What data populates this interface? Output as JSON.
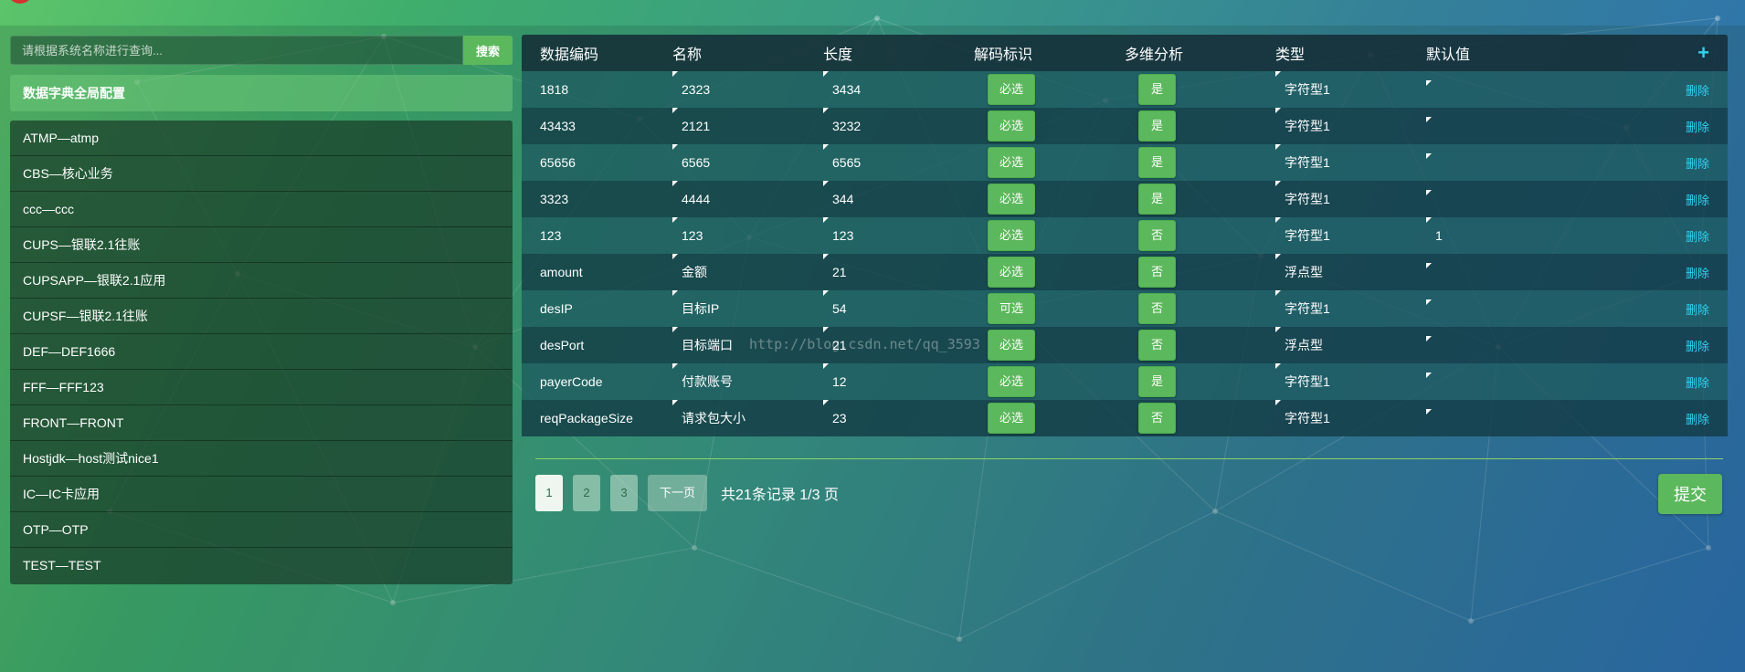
{
  "colors": {
    "accent_green": "#5cb85c",
    "link_cyan": "#2fd3f0"
  },
  "sidebar": {
    "search": {
      "placeholder": "请根据系统名称进行查询...",
      "button_label": "搜索"
    },
    "global_config_label": "数据字典全局配置",
    "systems": [
      "ATMP—atmp",
      "CBS—核心业务",
      "ccc—ccc",
      "CUPS—银联2.1往账",
      "CUPSAPP—银联2.1应用",
      "CUPSF—银联2.1往账",
      "DEF—DEF1666",
      "FFF—FFF123",
      "FRONT—FRONT",
      "Hostjdk—host测试nice1",
      "IC—IC卡应用",
      "OTP—OTP",
      "TEST—TEST"
    ]
  },
  "table": {
    "headers": [
      "数据编码",
      "名称",
      "长度",
      "解码标识",
      "多维分析",
      "类型",
      "默认值"
    ],
    "add_icon": "plus-icon",
    "add_symbol": "+",
    "delete_label": "删除",
    "rows": [
      {
        "code": "1818",
        "name": "2323",
        "length": "3434",
        "decode": "必选",
        "multi": "是",
        "type": "字符型1",
        "default": ""
      },
      {
        "code": "43433",
        "name": "2121",
        "length": "3232",
        "decode": "必选",
        "multi": "是",
        "type": "字符型1",
        "default": ""
      },
      {
        "code": "65656",
        "name": "6565",
        "length": "6565",
        "decode": "必选",
        "multi": "是",
        "type": "字符型1",
        "default": ""
      },
      {
        "code": "3323",
        "name": "4444",
        "length": "344",
        "decode": "必选",
        "multi": "是",
        "type": "字符型1",
        "default": ""
      },
      {
        "code": "123",
        "name": "123",
        "length": "123",
        "decode": "必选",
        "multi": "否",
        "type": "字符型1",
        "default": "1"
      },
      {
        "code": "amount",
        "name": "金额",
        "length": "21",
        "decode": "必选",
        "multi": "否",
        "type": "浮点型",
        "default": ""
      },
      {
        "code": "desIP",
        "name": "目标IP",
        "length": "54",
        "decode": "可选",
        "multi": "否",
        "type": "字符型1",
        "default": ""
      },
      {
        "code": "desPort",
        "name": "目标端口",
        "length": "21",
        "decode": "必选",
        "multi": "否",
        "type": "浮点型",
        "default": ""
      },
      {
        "code": "payerCode",
        "name": "付款账号",
        "length": "12",
        "decode": "必选",
        "multi": "是",
        "type": "字符型1",
        "default": ""
      },
      {
        "code": "reqPackageSize",
        "name": "请求包大小",
        "length": "23",
        "decode": "必选",
        "multi": "否",
        "type": "字符型1",
        "default": ""
      }
    ]
  },
  "pagination": {
    "pages": [
      "1",
      "2",
      "3"
    ],
    "current_page": "1",
    "next_label": "下一页",
    "info": "共21条记录 1/3 页"
  },
  "submit_label": "提交",
  "watermark": "http://blog.csdn.net/qq_3593"
}
